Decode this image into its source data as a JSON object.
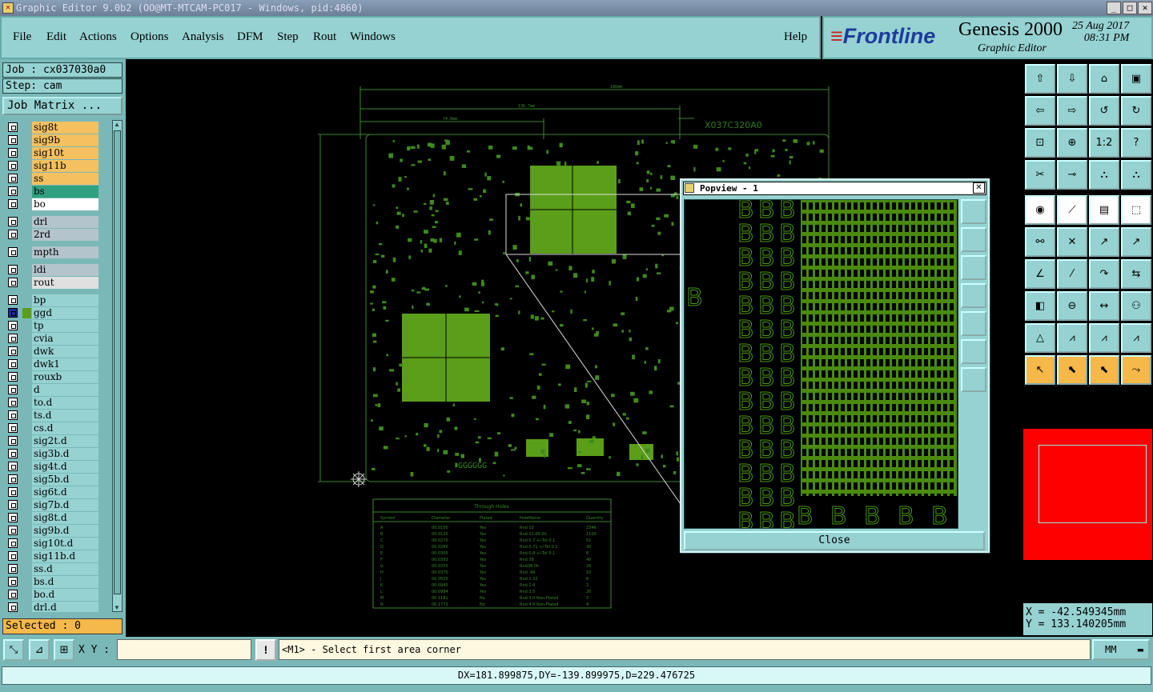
{
  "window": {
    "title": "Graphic Editor 9.0b2 (OO@MT-MTCAM-PC017 - Windows, pid:4860)"
  },
  "menu": {
    "items": [
      "File",
      "Edit",
      "Actions",
      "Options",
      "Analysis",
      "DFM",
      "Step",
      "Rout",
      "Windows"
    ],
    "help": "Help"
  },
  "brand": {
    "logo": "Frontline",
    "product": "Genesis 2000",
    "subtitle": "Graphic Editor",
    "date": "25 Aug 2017",
    "time": "08:31 PM"
  },
  "job": {
    "label": "Job : cx037030a0",
    "step": "Step: cam",
    "matrix_button": "Job Matrix ..."
  },
  "layers": [
    {
      "name": "sig8t",
      "color": "#f5c060"
    },
    {
      "name": "sig9b",
      "color": "#f5c060"
    },
    {
      "name": "sig10t",
      "color": "#f5c060"
    },
    {
      "name": "sig11b",
      "color": "#f5c060"
    },
    {
      "name": "ss",
      "color": "#f5c060"
    },
    {
      "name": "bs",
      "color": "#30a080"
    },
    {
      "name": "bo",
      "color": "#ffffff"
    },
    {
      "name": "drl",
      "color": "#b4c4cc",
      "gap": true
    },
    {
      "name": "2rd",
      "color": "#b4c4cc"
    },
    {
      "name": "mpth",
      "color": "#b4c4cc",
      "gap": true
    },
    {
      "name": "ldi",
      "color": "#b4c4cc",
      "gap": true
    },
    {
      "name": "rout",
      "color": "#e0e0e0"
    },
    {
      "name": "bp",
      "color": "#96d2d2",
      "gap": true
    },
    {
      "name": "ggd",
      "color": "#96d2d2",
      "active": true
    },
    {
      "name": "tp",
      "color": "#96d2d2"
    },
    {
      "name": "cvia",
      "color": "#96d2d2"
    },
    {
      "name": "dwk",
      "color": "#96d2d2"
    },
    {
      "name": "dwk1",
      "color": "#96d2d2"
    },
    {
      "name": "rouxb",
      "color": "#96d2d2"
    },
    {
      "name": "d",
      "color": "#96d2d2"
    },
    {
      "name": "to.d",
      "color": "#96d2d2"
    },
    {
      "name": "ts.d",
      "color": "#96d2d2"
    },
    {
      "name": "cs.d",
      "color": "#96d2d2"
    },
    {
      "name": "sig2t.d",
      "color": "#96d2d2"
    },
    {
      "name": "sig3b.d",
      "color": "#96d2d2"
    },
    {
      "name": "sig4t.d",
      "color": "#96d2d2"
    },
    {
      "name": "sig5b.d",
      "color": "#96d2d2"
    },
    {
      "name": "sig6t.d",
      "color": "#96d2d2"
    },
    {
      "name": "sig7b.d",
      "color": "#96d2d2"
    },
    {
      "name": "sig8t.d",
      "color": "#96d2d2"
    },
    {
      "name": "sig9b.d",
      "color": "#96d2d2"
    },
    {
      "name": "sig10t.d",
      "color": "#96d2d2"
    },
    {
      "name": "sig11b.d",
      "color": "#96d2d2"
    },
    {
      "name": "ss.d",
      "color": "#96d2d2"
    },
    {
      "name": "bs.d",
      "color": "#96d2d2"
    },
    {
      "name": "bo.d",
      "color": "#96d2d2"
    },
    {
      "name": "drl.d",
      "color": "#96d2d2"
    }
  ],
  "selected": "Selected : 0",
  "board": {
    "part_number": "X037C320A0",
    "dims": [
      "186mm",
      "136.7mm",
      "74.8mm"
    ],
    "table": {
      "title": "Through Holes",
      "headers": [
        "Symbol",
        "Diameter",
        "Plated",
        "HoleName",
        "Quantity"
      ],
      "rows": [
        [
          "A",
          "00.0100",
          "Yes",
          "Rnd 10",
          "2346"
        ],
        [
          "B",
          "00.0120",
          "Yes",
          "Rnd 12.00.0h",
          "1100"
        ],
        [
          "C",
          "00.0270",
          "Yes",
          "Rnd 0.7 +/-Tol 0.1",
          "51"
        ],
        [
          "D",
          "00.0280",
          "Yes",
          "Rnd 0.71 +/-Tol 0.1",
          "30"
        ],
        [
          "E",
          "00.0305",
          "Yes",
          "Rnd 0.8 +/-Tol 0.1",
          "8"
        ],
        [
          "F",
          "00.0393",
          "Yes",
          "Rnd 38",
          "40"
        ],
        [
          "G",
          "00.0355",
          "Yes",
          "Rnd38.0h",
          "26"
        ],
        [
          "H",
          "00.0370",
          "Yes",
          "Rnd .94",
          "10"
        ],
        [
          "J",
          "00.0520",
          "Yes",
          "Rnd 1.32",
          "8"
        ],
        [
          "K",
          "00.0945",
          "Yes",
          "Rnd 2.4",
          "2"
        ],
        [
          "L",
          "00.0984",
          "Yes",
          "Rnd 2.5",
          "20"
        ],
        [
          "M",
          "00.1181",
          "No",
          "Rnd 3.0 Non-Plated",
          "2"
        ],
        [
          "N",
          "00.1772",
          "No",
          "Rnd 4.5 Non-Plated",
          "4"
        ]
      ]
    },
    "grid_letters": "GGGGGG"
  },
  "popview": {
    "title": "Popview - 1",
    "close": "Close"
  },
  "coords": {
    "x": "X = -42.549345mm",
    "y": "Y = 133.140205mm"
  },
  "bottom": {
    "xy_label": "X Y :",
    "prompt": "<M1> - Select first area corner",
    "unit": "MM"
  },
  "status": "DX=181.899875,DY=-139.899975,D=229.476725"
}
